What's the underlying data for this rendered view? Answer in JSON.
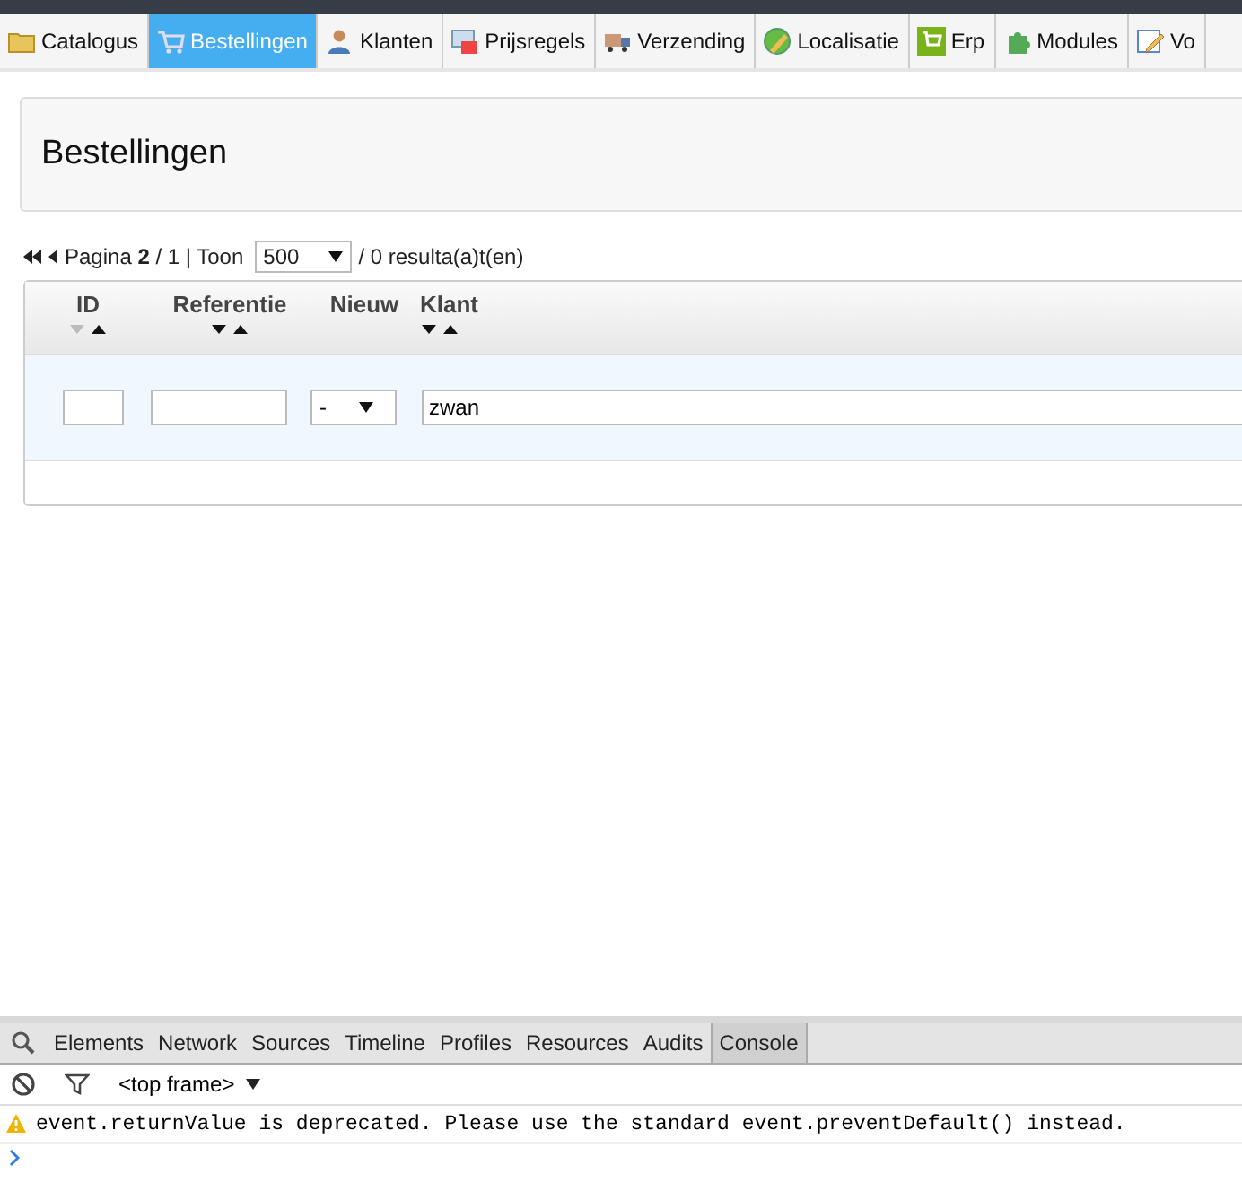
{
  "tabs": [
    {
      "label": "Catalogus",
      "selected": false
    },
    {
      "label": "Bestellingen",
      "selected": true
    },
    {
      "label": "Klanten",
      "selected": false
    },
    {
      "label": "Prijsregels",
      "selected": false
    },
    {
      "label": "Verzending",
      "selected": false
    },
    {
      "label": "Localisatie",
      "selected": false
    },
    {
      "label": "Erp",
      "selected": false
    },
    {
      "label": "Modules",
      "selected": false
    },
    {
      "label": "Vo",
      "selected": false
    }
  ],
  "page_title": "Bestellingen",
  "pagination": {
    "text": "Pagina **2** / 1 | Toon",
    "per_page": "500",
    "results": "/ 0 resulta(a)t(en)"
  },
  "table": {
    "columns": [
      {
        "label": "ID",
        "sortable": true,
        "desc_dimmed": true
      },
      {
        "label": "Referentie",
        "sortable": true,
        "desc_dimmed": false
      },
      {
        "label": "Nieuw",
        "sortable": false
      },
      {
        "label": "Klant",
        "sortable": true,
        "desc_dimmed": false
      }
    ],
    "filters": [
      {
        "kind": "input"
      },
      {
        "kind": "input"
      },
      {
        "kind": "select",
        "value": "-"
      },
      {
        "kind": "input",
        "value": "zwan"
      }
    ]
  },
  "devtools": {
    "tabs": [
      {
        "label": "Elements",
        "selected": false
      },
      {
        "label": "Network",
        "selected": false
      },
      {
        "label": "Sources",
        "selected": false
      },
      {
        "label": "Timeline",
        "selected": false
      },
      {
        "label": "Profiles",
        "selected": false
      },
      {
        "label": "Resources",
        "selected": false
      },
      {
        "label": "Audits",
        "selected": false
      },
      {
        "label": "Console",
        "selected": true
      }
    ],
    "frame": "<top frame>",
    "messages": [
      {
        "kind": "warning",
        "text": "event.returnValue is deprecated. Please use the standard event.preventDefault() instead."
      }
    ]
  }
}
